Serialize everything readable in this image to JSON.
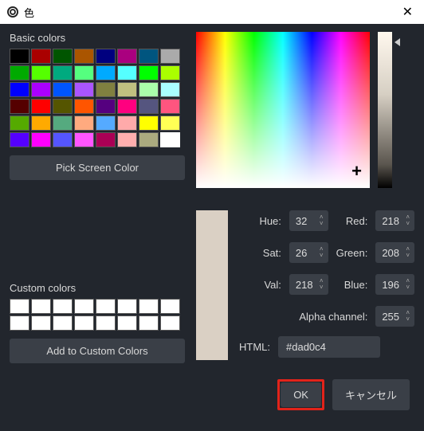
{
  "title": "色",
  "labels": {
    "basic_colors": "Basic colors",
    "pick_screen": "Pick Screen Color",
    "custom_colors": "Custom colors",
    "add_custom": "Add to Custom Colors",
    "hue": "Hue:",
    "sat": "Sat:",
    "val": "Val:",
    "red": "Red:",
    "green": "Green:",
    "blue": "Blue:",
    "alpha": "Alpha channel:",
    "html": "HTML:",
    "ok": "OK",
    "cancel": "キャンセル"
  },
  "values": {
    "hue": "32",
    "sat": "26",
    "val": "218",
    "red": "218",
    "green": "208",
    "blue": "196",
    "alpha": "255",
    "html": "#dad0c4"
  },
  "basic_colors": [
    "#000000",
    "#aa0000",
    "#005500",
    "#aa5500",
    "#00007f",
    "#aa007f",
    "#00557f",
    "#aaaaaa",
    "#00aa00",
    "#55ff00",
    "#00aa7f",
    "#55ff7f",
    "#00aaff",
    "#55ffff",
    "#00ff00",
    "#aaff00",
    "#0000ff",
    "#aa00ff",
    "#0055ff",
    "#aa55ff",
    "#808040",
    "#c0c080",
    "#aaffaa",
    "#aaffff",
    "#550000",
    "#ff0000",
    "#555500",
    "#ff5500",
    "#55007f",
    "#ff007f",
    "#55557f",
    "#ff557f",
    "#55aa00",
    "#ffaa00",
    "#55aa7f",
    "#ffaa7f",
    "#55aaff",
    "#ffaaaa",
    "#ffff00",
    "#ffff55",
    "#5500ff",
    "#ff00ff",
    "#5555ff",
    "#ff55ff",
    "#aa0055",
    "#ffafaf",
    "#aaaa7f",
    "#ffffff"
  ],
  "selected_swatch_index": 47,
  "current_color": "#dad0c4"
}
